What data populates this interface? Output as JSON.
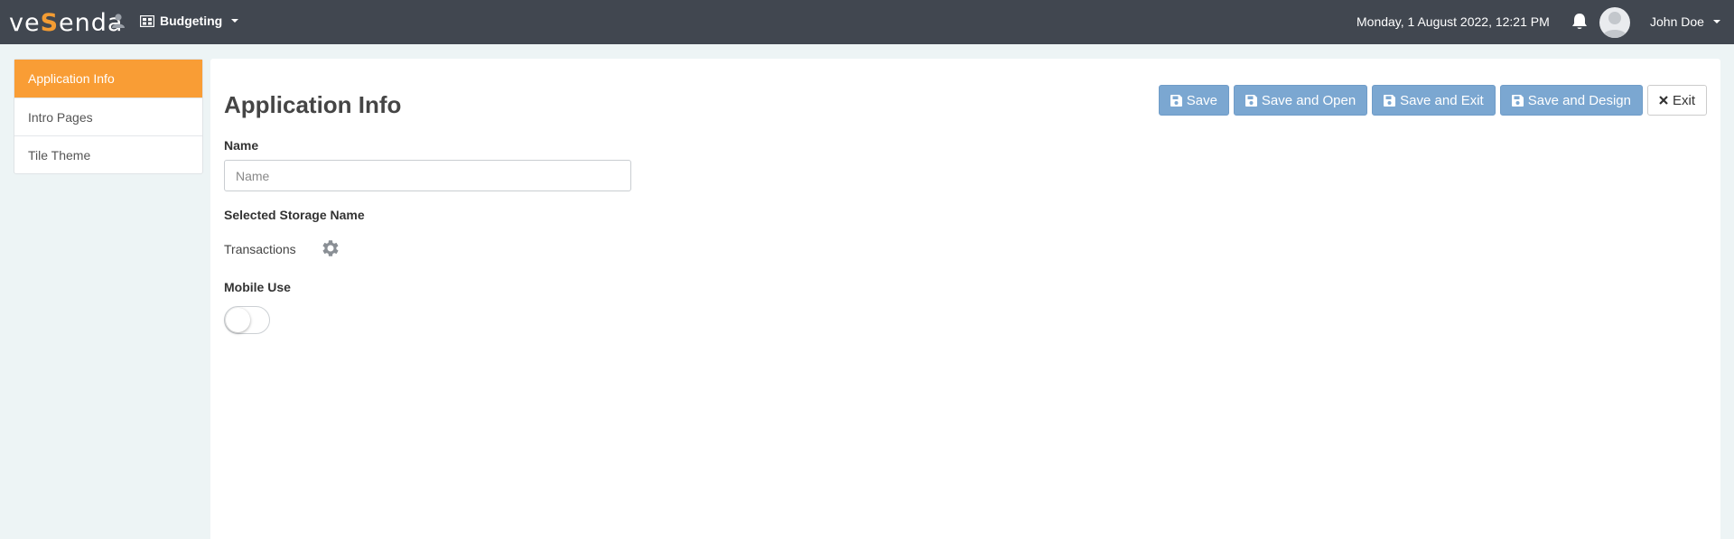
{
  "header": {
    "logo_text": "veSenda",
    "logo_prefix": "ve",
    "logo_highlight": "S",
    "logo_suffix": "enda",
    "app_name": "Budgeting",
    "datetime": "Monday, 1 August 2022, 12:21 PM",
    "user_name": "John Doe",
    "icons": [
      "user-icon",
      "apps-icon",
      "bell-icon",
      "avatar",
      "chevron-down-icon"
    ]
  },
  "sidebar": {
    "items": [
      {
        "label": "Application Info",
        "active": true
      },
      {
        "label": "Intro Pages",
        "active": false
      },
      {
        "label": "Tile Theme",
        "active": false
      }
    ]
  },
  "main": {
    "title": "Application Info",
    "buttons": {
      "save": "Save",
      "save_open": "Save and Open",
      "save_exit": "Save and Exit",
      "save_design": "Save and Design",
      "exit": "Exit"
    },
    "name_label": "Name",
    "name_value": "",
    "name_placeholder": "Name",
    "storage_label": "Selected Storage Name",
    "storage_value": "Transactions",
    "mobile_label": "Mobile Use",
    "mobile_enabled": false
  },
  "colors": {
    "topbar": "#414750",
    "accent": "#f99d35",
    "primary_button": "#7ba7d1",
    "background": "#edf4f5"
  }
}
